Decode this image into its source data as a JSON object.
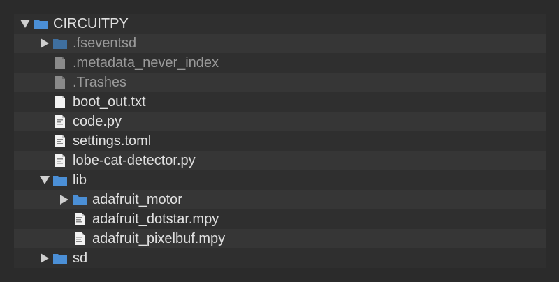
{
  "colors": {
    "background": "#2b2b2b",
    "panel": "#2f2f2f",
    "row_alt": "#363636",
    "text": "#e0e0e0",
    "text_dim": "#9a9a9a",
    "folder_blue": "#4b8fd6",
    "folder_dim": "#3f6f9f"
  },
  "tree": [
    {
      "label": "CIRCUITPY",
      "icon": "folder-icon",
      "toggle": "expanded"
    },
    {
      "label": ".fseventsd",
      "icon": "folder-icon",
      "toggle": "collapsed",
      "dim": true
    },
    {
      "label": ".metadata_never_index",
      "icon": "file-icon",
      "dim": true
    },
    {
      "label": ".Trashes",
      "icon": "file-icon",
      "dim": true
    },
    {
      "label": "boot_out.txt",
      "icon": "file-icon"
    },
    {
      "label": "code.py",
      "icon": "code-file-icon"
    },
    {
      "label": "settings.toml",
      "icon": "code-file-icon"
    },
    {
      "label": "lobe-cat-detector.py",
      "icon": "code-file-icon"
    },
    {
      "label": "lib",
      "icon": "folder-icon",
      "toggle": "expanded"
    },
    {
      "label": "adafruit_motor",
      "icon": "folder-icon",
      "toggle": "collapsed"
    },
    {
      "label": "adafruit_dotstar.mpy",
      "icon": "code-file-icon"
    },
    {
      "label": "adafruit_pixelbuf.mpy",
      "icon": "code-file-icon"
    },
    {
      "label": "sd",
      "icon": "folder-icon",
      "toggle": "collapsed"
    }
  ]
}
